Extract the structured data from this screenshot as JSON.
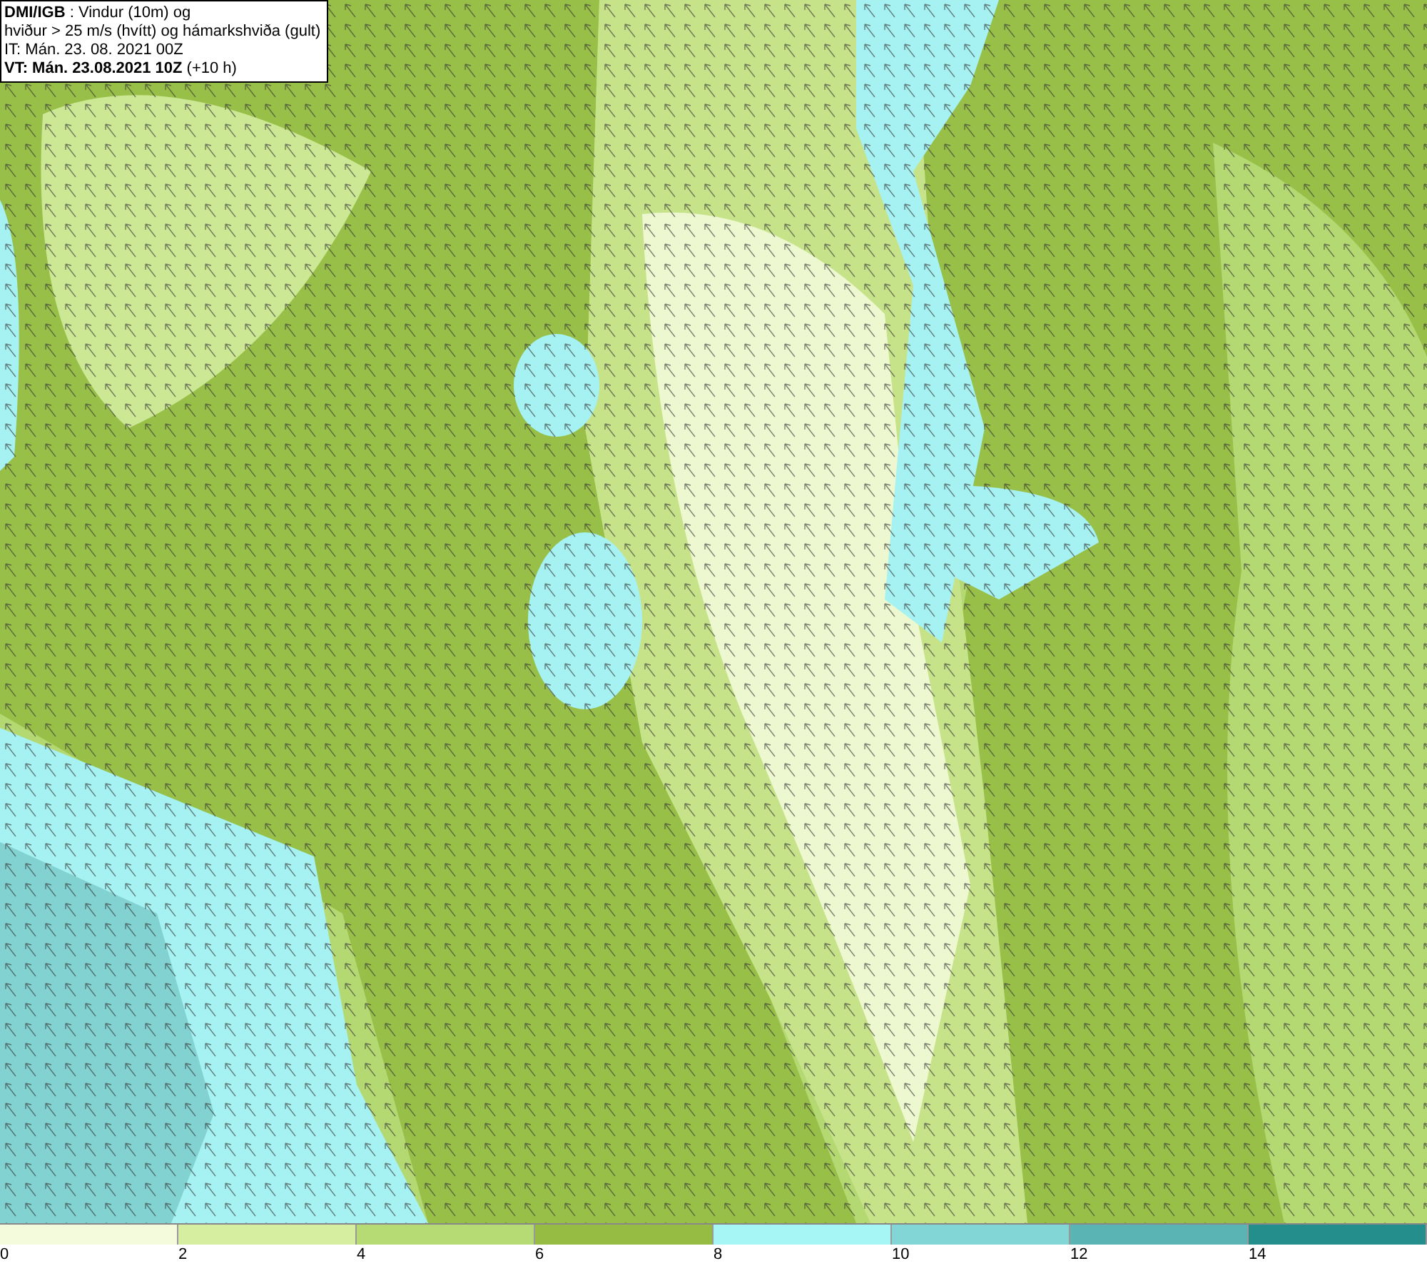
{
  "header": {
    "lines": [
      "**DMI/IGB** : Vindur (10m) og",
      "hviður > 25 m/s (hvítt) og hámarkshviða (gult)",
      "IT: Mán. 23. 08. 2021 00Z",
      "**VT: Mán. 23.08.2021 10Z** (+10 h)"
    ]
  },
  "colorbar": {
    "segments": [
      {
        "color": "#f4fbdc"
      },
      {
        "color": "#d6eea0"
      },
      {
        "color": "#b6da74"
      },
      {
        "color": "#96bc44"
      },
      {
        "color": "#a6f6f6"
      },
      {
        "color": "#82d6d6"
      },
      {
        "color": "#5ab4b4"
      },
      {
        "color": "#248e8c"
      }
    ],
    "ticks": [
      "0",
      "2",
      "4",
      "6",
      "8",
      "10",
      "12",
      "14"
    ]
  }
}
